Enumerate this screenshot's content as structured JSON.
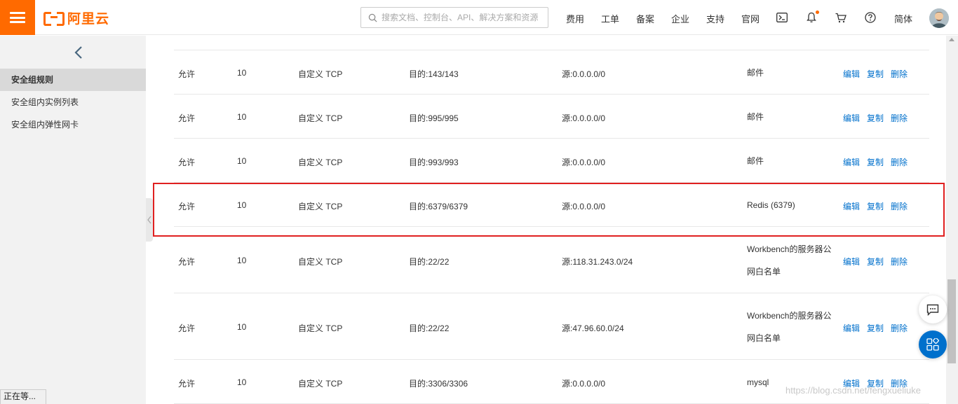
{
  "header": {
    "logo_text": "阿里云",
    "search_placeholder": "搜索文档、控制台、API、解决方案和资源",
    "nav": [
      "费用",
      "工单",
      "备案",
      "企业",
      "支持",
      "官网"
    ],
    "lang": "简体",
    "icons": [
      "terminal-icon",
      "bell-icon",
      "cart-icon",
      "help-icon"
    ]
  },
  "sidebar": {
    "items": [
      "安全组规则",
      "安全组内实例列表",
      "安全组内弹性网卡"
    ],
    "active_index": 0
  },
  "status_bar": "正在等...",
  "table": {
    "actions": [
      "编辑",
      "复制",
      "删除"
    ],
    "rows": [
      {
        "policy": "允许",
        "priority": "10",
        "protocol": "自定义 TCP",
        "port": "目的:143/143",
        "source": "源:0.0.0.0/0",
        "desc": "邮件"
      },
      {
        "policy": "允许",
        "priority": "10",
        "protocol": "自定义 TCP",
        "port": "目的:995/995",
        "source": "源:0.0.0.0/0",
        "desc": "邮件"
      },
      {
        "policy": "允许",
        "priority": "10",
        "protocol": "自定义 TCP",
        "port": "目的:993/993",
        "source": "源:0.0.0.0/0",
        "desc": "邮件"
      },
      {
        "policy": "允许",
        "priority": "10",
        "protocol": "自定义 TCP",
        "port": "目的:6379/6379",
        "source": "源:0.0.0.0/0",
        "desc": "Redis (6379)"
      },
      {
        "policy": "允许",
        "priority": "10",
        "protocol": "自定义 TCP",
        "port": "目的:22/22",
        "source": "源:118.31.243.0/24",
        "desc": "Workbench的服务器公网白名单"
      },
      {
        "policy": "允许",
        "priority": "10",
        "protocol": "自定义 TCP",
        "port": "目的:22/22",
        "source": "源:47.96.60.0/24",
        "desc": "Workbench的服务器公网白名单"
      },
      {
        "policy": "允许",
        "priority": "10",
        "protocol": "自定义 TCP",
        "port": "目的:3306/3306",
        "source": "源:0.0.0.0/0",
        "desc": "mysql"
      }
    ]
  },
  "highlighted_row_index": 3,
  "watermark": "https://blog.csdn.net/fengxueliuke",
  "colors": {
    "brand": "#ff6a00",
    "link": "#0070cc",
    "highlight": "#e02020"
  }
}
